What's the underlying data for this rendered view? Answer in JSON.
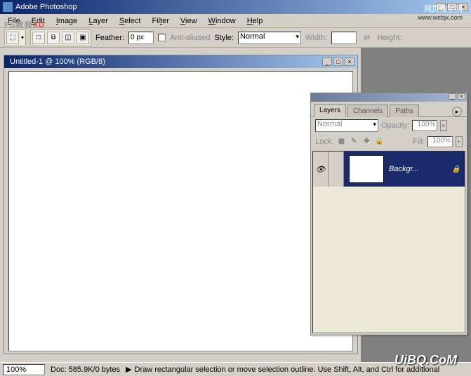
{
  "app": {
    "title": "Adobe Photoshop"
  },
  "menu": {
    "file": "File",
    "edit": "Edit",
    "image": "Image",
    "layer": "Layer",
    "select": "Select",
    "filter": "Filter",
    "view": "View",
    "window": "Window",
    "help": "Help"
  },
  "toolbar": {
    "feather_label": "Feather:",
    "feather_value": "0 px",
    "antialiased": "Anti-aliased",
    "style": "Style:",
    "style_value": "Normal",
    "width": "Width:",
    "height": "Height:"
  },
  "doc": {
    "title": "Untitled-1 @ 100% (RGB/8)"
  },
  "status": {
    "zoom": "100%",
    "docinfo": "Doc: 585.9K/0 bytes",
    "hint": "Draw rectangular selection or move selection outline. Use Shift, Alt, and Ctrl for additional"
  },
  "palette": {
    "tabs": {
      "layers": "Layers",
      "channels": "Channels",
      "paths": "Paths"
    },
    "blend": "Normal",
    "opacity_label": "Opacity:",
    "opacity": "100%",
    "lock_label": "Lock:",
    "fill_label": "Fill:",
    "fill": "100%",
    "layer": {
      "name": "Backgr..."
    }
  },
  "watermarks": {
    "site": "网页教学网",
    "url": "www.webjx.com",
    "brand": "UiBQ.CoM",
    "wm_g": "PS教程",
    "wm_r": "XD"
  }
}
